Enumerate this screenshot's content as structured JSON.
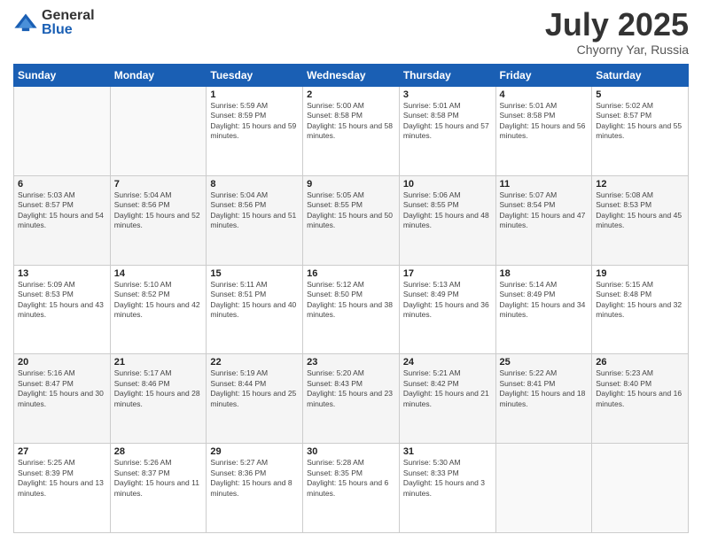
{
  "logo": {
    "general": "General",
    "blue": "Blue"
  },
  "title": "July 2025",
  "location": "Chyorny Yar, Russia",
  "weekdays": [
    "Sunday",
    "Monday",
    "Tuesday",
    "Wednesday",
    "Thursday",
    "Friday",
    "Saturday"
  ],
  "rows": [
    [
      null,
      null,
      {
        "day": "1",
        "rise": "5:59 AM",
        "set": "8:59 PM",
        "daylight": "15 hours and 59 minutes."
      },
      {
        "day": "2",
        "rise": "5:00 AM",
        "set": "8:58 PM",
        "daylight": "15 hours and 58 minutes."
      },
      {
        "day": "3",
        "rise": "5:01 AM",
        "set": "8:58 PM",
        "daylight": "15 hours and 57 minutes."
      },
      {
        "day": "4",
        "rise": "5:01 AM",
        "set": "8:58 PM",
        "daylight": "15 hours and 56 minutes."
      },
      {
        "day": "5",
        "rise": "5:02 AM",
        "set": "8:57 PM",
        "daylight": "15 hours and 55 minutes."
      }
    ],
    [
      {
        "day": "6",
        "rise": "5:03 AM",
        "set": "8:57 PM",
        "daylight": "15 hours and 54 minutes."
      },
      {
        "day": "7",
        "rise": "5:04 AM",
        "set": "8:56 PM",
        "daylight": "15 hours and 52 minutes."
      },
      {
        "day": "8",
        "rise": "5:04 AM",
        "set": "8:56 PM",
        "daylight": "15 hours and 51 minutes."
      },
      {
        "day": "9",
        "rise": "5:05 AM",
        "set": "8:55 PM",
        "daylight": "15 hours and 50 minutes."
      },
      {
        "day": "10",
        "rise": "5:06 AM",
        "set": "8:55 PM",
        "daylight": "15 hours and 48 minutes."
      },
      {
        "day": "11",
        "rise": "5:07 AM",
        "set": "8:54 PM",
        "daylight": "15 hours and 47 minutes."
      },
      {
        "day": "12",
        "rise": "5:08 AM",
        "set": "8:53 PM",
        "daylight": "15 hours and 45 minutes."
      }
    ],
    [
      {
        "day": "13",
        "rise": "5:09 AM",
        "set": "8:53 PM",
        "daylight": "15 hours and 43 minutes."
      },
      {
        "day": "14",
        "rise": "5:10 AM",
        "set": "8:52 PM",
        "daylight": "15 hours and 42 minutes."
      },
      {
        "day": "15",
        "rise": "5:11 AM",
        "set": "8:51 PM",
        "daylight": "15 hours and 40 minutes."
      },
      {
        "day": "16",
        "rise": "5:12 AM",
        "set": "8:50 PM",
        "daylight": "15 hours and 38 minutes."
      },
      {
        "day": "17",
        "rise": "5:13 AM",
        "set": "8:49 PM",
        "daylight": "15 hours and 36 minutes."
      },
      {
        "day": "18",
        "rise": "5:14 AM",
        "set": "8:49 PM",
        "daylight": "15 hours and 34 minutes."
      },
      {
        "day": "19",
        "rise": "5:15 AM",
        "set": "8:48 PM",
        "daylight": "15 hours and 32 minutes."
      }
    ],
    [
      {
        "day": "20",
        "rise": "5:16 AM",
        "set": "8:47 PM",
        "daylight": "15 hours and 30 minutes."
      },
      {
        "day": "21",
        "rise": "5:17 AM",
        "set": "8:46 PM",
        "daylight": "15 hours and 28 minutes."
      },
      {
        "day": "22",
        "rise": "5:19 AM",
        "set": "8:44 PM",
        "daylight": "15 hours and 25 minutes."
      },
      {
        "day": "23",
        "rise": "5:20 AM",
        "set": "8:43 PM",
        "daylight": "15 hours and 23 minutes."
      },
      {
        "day": "24",
        "rise": "5:21 AM",
        "set": "8:42 PM",
        "daylight": "15 hours and 21 minutes."
      },
      {
        "day": "25",
        "rise": "5:22 AM",
        "set": "8:41 PM",
        "daylight": "15 hours and 18 minutes."
      },
      {
        "day": "26",
        "rise": "5:23 AM",
        "set": "8:40 PM",
        "daylight": "15 hours and 16 minutes."
      }
    ],
    [
      {
        "day": "27",
        "rise": "5:25 AM",
        "set": "8:39 PM",
        "daylight": "15 hours and 13 minutes."
      },
      {
        "day": "28",
        "rise": "5:26 AM",
        "set": "8:37 PM",
        "daylight": "15 hours and 11 minutes."
      },
      {
        "day": "29",
        "rise": "5:27 AM",
        "set": "8:36 PM",
        "daylight": "15 hours and 8 minutes."
      },
      {
        "day": "30",
        "rise": "5:28 AM",
        "set": "8:35 PM",
        "daylight": "15 hours and 6 minutes."
      },
      {
        "day": "31",
        "rise": "5:30 AM",
        "set": "8:33 PM",
        "daylight": "15 hours and 3 minutes."
      },
      null,
      null
    ]
  ],
  "labels": {
    "sunrise": "Sunrise:",
    "sunset": "Sunset:",
    "daylight": "Daylight:"
  }
}
